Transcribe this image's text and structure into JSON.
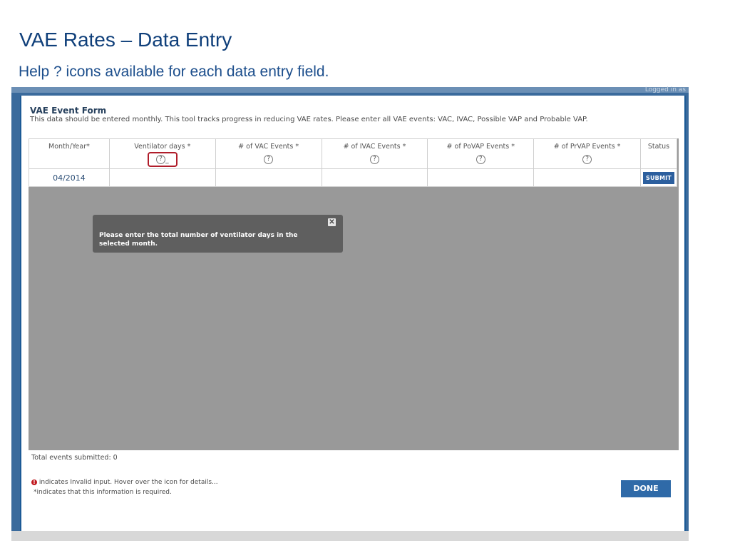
{
  "slide": {
    "title": "VAE Rates – Data Entry",
    "subtitle": "Help ? icons available for each data entry field."
  },
  "backdrop": {
    "corner_text": "Logged in as"
  },
  "form": {
    "title": "VAE Event Form",
    "description": "This data should be entered monthly. This tool tracks progress in reducing VAE rates. Please enter all VAE events: VAC, IVAC, Possible VAP and Probable VAP.",
    "columns": [
      {
        "label": "Month/Year*"
      },
      {
        "label": "Ventilator days *"
      },
      {
        "label": "# of VAC Events *"
      },
      {
        "label": "# of IVAC Events *"
      },
      {
        "label": "# of PoVAP Events *"
      },
      {
        "label": "# of PrVAP Events *"
      },
      {
        "label": "Status"
      }
    ],
    "row": {
      "month_year": "04/2014",
      "submit_label": "SUBMIT"
    },
    "help_glyph": "?",
    "tooltip": {
      "text": "Please enter the total number of ventilator days in the selected month.",
      "close_glyph": "✕"
    },
    "total_events": "Total events submitted: 0",
    "legend_invalid_icon": "!",
    "legend_invalid": "indicates Invalid input. Hover over the icon for details...",
    "legend_required": "*indicates that this information is required.",
    "done_label": "DONE"
  },
  "colors": {
    "accent": "#2c5f9e",
    "title": "#0f3f7a",
    "highlight": "#b01d2a"
  }
}
